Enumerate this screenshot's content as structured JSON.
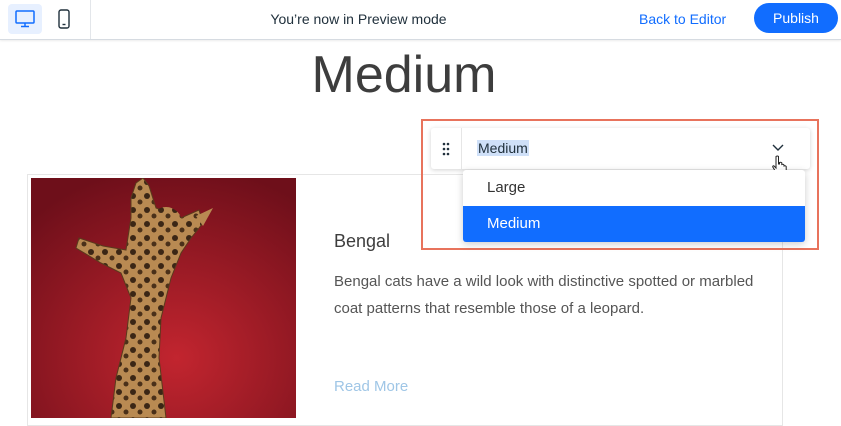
{
  "topbar": {
    "devices": [
      {
        "name": "desktop-icon",
        "active": true
      },
      {
        "name": "mobile-icon",
        "active": false
      }
    ],
    "preview_message": "You’re now in Preview mode",
    "back_label": "Back to Editor",
    "publish_label": "Publish"
  },
  "page": {
    "title": "Medium"
  },
  "card": {
    "title": "Bengal",
    "description": "Bengal cats have a wild look with distinctive spotted or marbled coat patterns that resemble those of a leopard.",
    "read_more": "Read More"
  },
  "dropdown": {
    "selected": "Medium",
    "options": [
      "Large",
      "Medium"
    ],
    "highlighted_index": 1
  },
  "colors": {
    "accent": "#116dff",
    "highlight_border": "#e8735c",
    "image_background": "#8e1422",
    "read_more": "#9fc6e6"
  }
}
